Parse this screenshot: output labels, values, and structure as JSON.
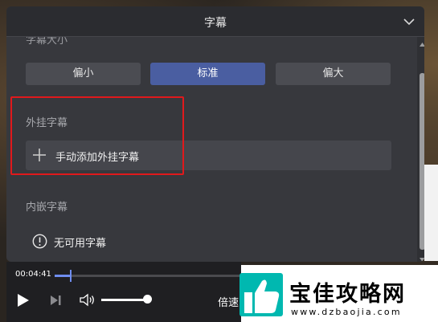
{
  "panel": {
    "title": "字幕",
    "cut_section_label": "字幕大小",
    "size_options": [
      {
        "label": "偏小",
        "active": false
      },
      {
        "label": "标准",
        "active": true
      },
      {
        "label": "偏大",
        "active": false
      }
    ],
    "external": {
      "title": "外挂字幕",
      "add_label": "手动添加外挂字幕"
    },
    "embedded": {
      "title": "内嵌字幕",
      "none_label": "无可用字幕"
    }
  },
  "player": {
    "time": "00:04:41",
    "speed_label": "倍速",
    "progress": 0.08,
    "volume": 0.9
  },
  "watermark": {
    "name": "宝佳攻略网",
    "url": "www.dzbaojia.com"
  },
  "colors": {
    "panel_bg": "#37383d",
    "active_button": "#4a5ea1",
    "highlight_border": "#e0191c",
    "progress_accent": "#6f8df0",
    "watermark_logo": "#00b8b0"
  }
}
